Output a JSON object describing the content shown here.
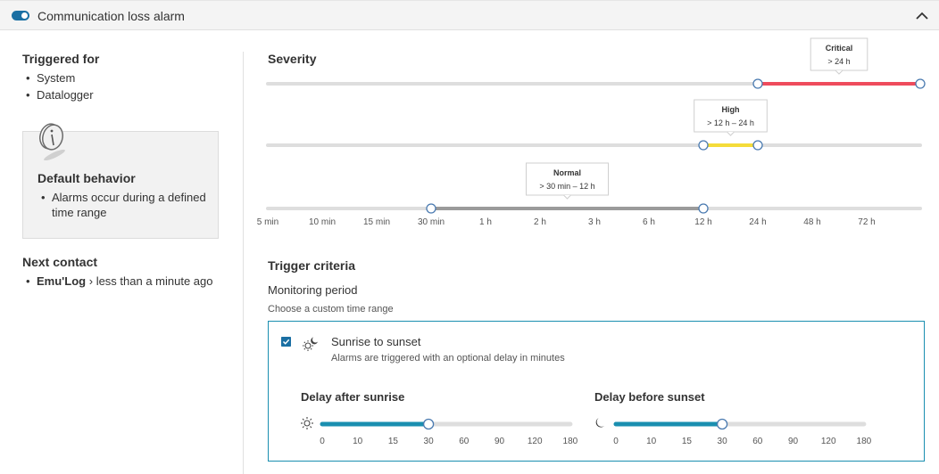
{
  "header": {
    "title": "Communication loss alarm",
    "toggle_on": true
  },
  "triggered_for": {
    "title": "Triggered for",
    "items": [
      "System",
      "Datalogger"
    ]
  },
  "default_behavior": {
    "title": "Default behavior",
    "items": [
      "Alarms occur during a defined time range"
    ]
  },
  "next_contact": {
    "title": "Next contact",
    "device": "Emu'Log",
    "separator": "›",
    "time": "less than a minute ago"
  },
  "severity": {
    "title": "Severity",
    "ticks": [
      "5 min",
      "10 min",
      "15 min",
      "30 min",
      "1 h",
      "2 h",
      "3 h",
      "6 h",
      "12 h",
      "24 h",
      "48 h",
      "72 h"
    ],
    "levels": [
      {
        "label": "Critical",
        "range": "> 24 h",
        "from_tick": 9,
        "to_tick": 12,
        "color": "#ef4b5c"
      },
      {
        "label": "High",
        "range": "> 12 h – 24 h",
        "from_tick": 8,
        "to_tick": 9,
        "color": "#f5dc3a"
      },
      {
        "label": "Normal",
        "range": "> 30 min – 12 h",
        "from_tick": 3,
        "to_tick": 8,
        "color": "#9b9b9b"
      }
    ]
  },
  "trigger_criteria": {
    "title": "Trigger criteria",
    "monitoring_period": "Monitoring period",
    "hint": "Choose a custom time range",
    "option": {
      "checked": true,
      "icon": "sun-moon-icon",
      "title": "Sunrise to sunset",
      "subtitle": "Alarms are triggered with an optional delay in minutes"
    },
    "sunrise": {
      "title": "Delay after sunrise",
      "icon": "sun-icon",
      "ticks": [
        "0",
        "10",
        "15",
        "30",
        "60",
        "90",
        "120",
        "180"
      ],
      "value": 30
    },
    "sunset": {
      "title": "Delay before sunset",
      "icon": "moon-icon",
      "ticks": [
        "0",
        "10",
        "15",
        "30",
        "60",
        "90",
        "120",
        "180"
      ],
      "value": 30
    }
  },
  "colors": {
    "accent": "#1a8fb0",
    "toggle": "#1a6fa3",
    "track": "#dedede"
  }
}
